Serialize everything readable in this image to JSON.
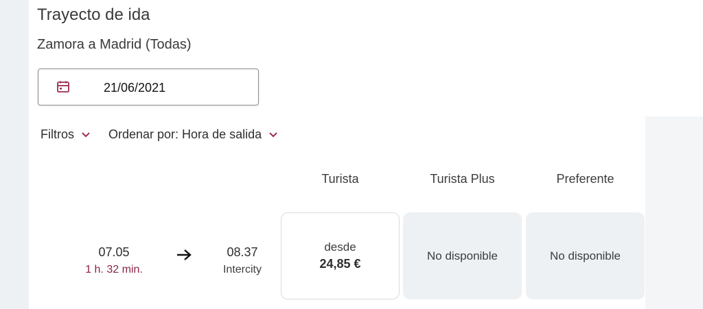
{
  "header": {
    "title": "Trayecto de ida",
    "route": "Zamora a Madrid (Todas)"
  },
  "date_picker": {
    "value": "21/06/2021",
    "icon": "calendar-icon"
  },
  "toolbar": {
    "filters_label": "Filtros",
    "sort_label": "Ordenar por: Hora de salida"
  },
  "columns": [
    "Turista",
    "Turista Plus",
    "Preferente"
  ],
  "trip": {
    "departure": "07.05",
    "duration": "1 h. 32 min.",
    "arrival": "08.37",
    "train_type": "Intercity",
    "fares": [
      {
        "from_label": "desde",
        "price": "24,85 €"
      },
      {
        "status": "No disponible"
      },
      {
        "status": "No disponible"
      }
    ]
  },
  "colors": {
    "accent": "#9b2c4e",
    "unavailable_bg": "#eef1f4",
    "text": "#3c3c3c"
  }
}
